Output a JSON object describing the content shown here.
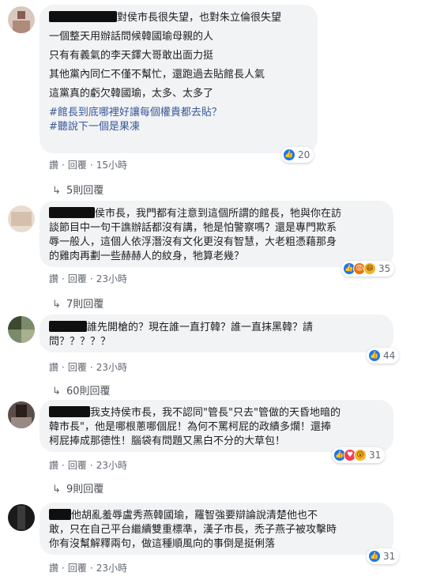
{
  "comments": [
    {
      "lines": [
        "對侯市長很失望，也對朱立倫很失望",
        "一個整天用辦話問候韓國瑜母親的人",
        "只有有義氣的李天鐸大哥敢出面力挺",
        "其他黨內同仁不僅不幫忙，還跑過去貼館長人氣",
        "這黨真的虧欠韓國瑜，太多、太多了"
      ],
      "tags": [
        "#館長到底哪裡好讓每個權貴都去貼？",
        "#聽說下一個是果凍"
      ],
      "reaction_count": "20",
      "meta": {
        "like": "讚",
        "reply": "回覆",
        "time": "15小時"
      },
      "replies": "5則回覆"
    },
    {
      "lines": [
        "侯市長，我門都有注意到這個所謂的館長，牠與你在訪",
        "談節目中一句干譙辦話都沒有講，牠是怕警察嗎？還是專門欺系",
        "辱一般人，這個人依浮潛沒有文化更沒有智慧，大老粗憑藉那身",
        "的雞肉再劃一些赫赫人的紋身，牠算老幾？"
      ],
      "reaction_count": "35",
      "meta": {
        "like": "讚",
        "reply": "回覆",
        "time": "23小時"
      },
      "replies": "7則回覆"
    },
    {
      "lines": [
        "誰先開槍的？現在誰一直打韓？誰一直抹黑韓？請",
        "問？？？？？"
      ],
      "reaction_count": "44",
      "meta": {
        "like": "讚",
        "reply": "回覆",
        "time": "23小時"
      },
      "replies": "60則回覆"
    },
    {
      "lines": [
        "我支持侯市長，我不認同\"管長\"只去\"管做的天昏地暗的",
        "韓市長\"，他是哪根蔥哪個屁！為何不罵柯屁的政績多爛！還捧",
        "柯屁捧成那德性！腦袋有問題又黑白不分的大草包！"
      ],
      "reaction_count": "31",
      "meta": {
        "like": "讚",
        "reply": "回覆",
        "time": "23小時"
      },
      "replies": "9則回覆"
    },
    {
      "lines": [
        "他胡亂羞辱盧秀燕韓國瑜，羅智強要辯論說清楚他也不",
        "敢，只在自己平台繼續雙重標準，漢子市長，禿子燕子被攻擊時",
        "你有沒幫解釋兩句，做這種順風向的事倒是挺俐落"
      ],
      "reaction_count": "31",
      "meta": {
        "like": "讚",
        "reply": "回覆",
        "time": "23小時"
      },
      "replies": ""
    }
  ],
  "icons": {
    "like": "like-reaction-icon",
    "angry": "angry-reaction-icon",
    "haha": "haha-reaction-icon",
    "love": "love-reaction-icon",
    "wow": "wow-reaction-icon",
    "reply_arrow": "reply-arrow-icon"
  },
  "colors": {
    "bubble": "#f2f3f5",
    "link": "#385898",
    "like": "#1877f2",
    "meta": "#606770"
  }
}
